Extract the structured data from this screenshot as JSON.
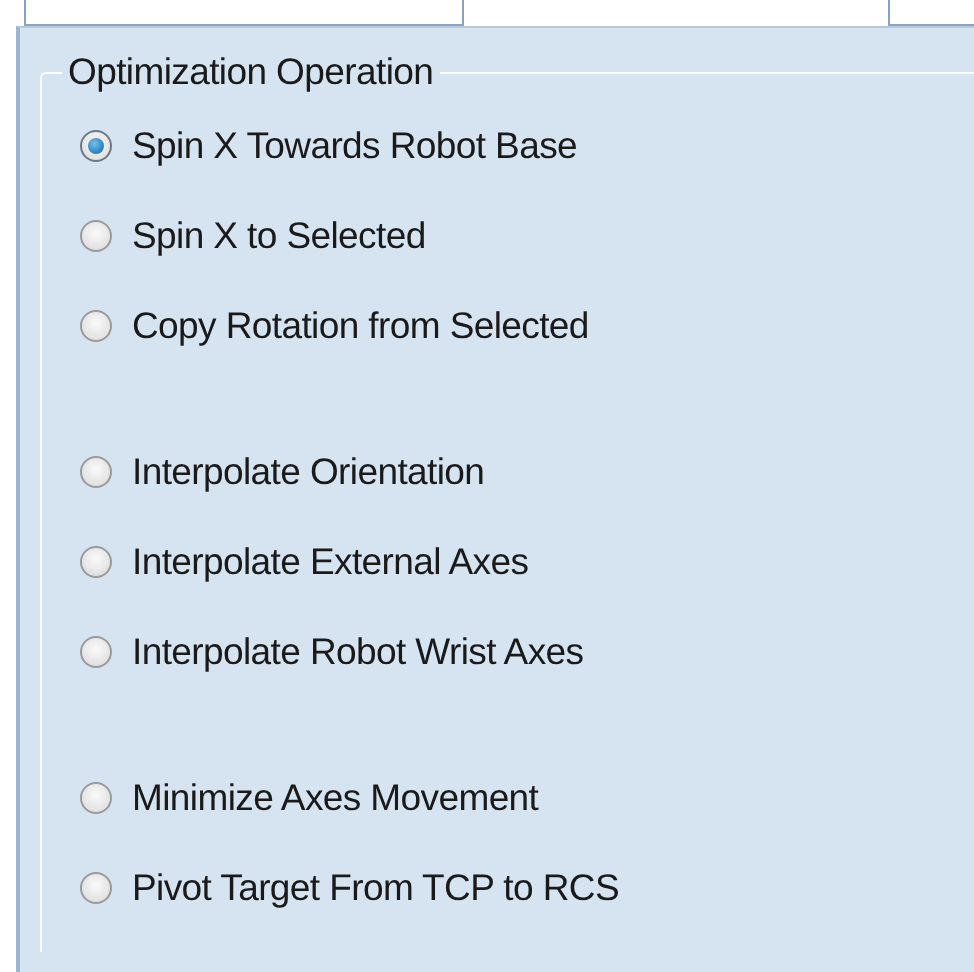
{
  "group_box": {
    "title": "Optimization Operation",
    "option_groups": [
      {
        "options": [
          {
            "label": "Spin X Towards Robot Base",
            "selected": true
          },
          {
            "label": "Spin X to Selected",
            "selected": false
          },
          {
            "label": "Copy Rotation from Selected",
            "selected": false
          }
        ]
      },
      {
        "options": [
          {
            "label": "Interpolate Orientation",
            "selected": false
          },
          {
            "label": "Interpolate External Axes",
            "selected": false
          },
          {
            "label": "Interpolate Robot Wrist Axes",
            "selected": false
          }
        ]
      },
      {
        "options": [
          {
            "label": "Minimize Axes Movement",
            "selected": false
          },
          {
            "label": "Pivot Target From TCP to RCS",
            "selected": false
          }
        ]
      }
    ]
  }
}
